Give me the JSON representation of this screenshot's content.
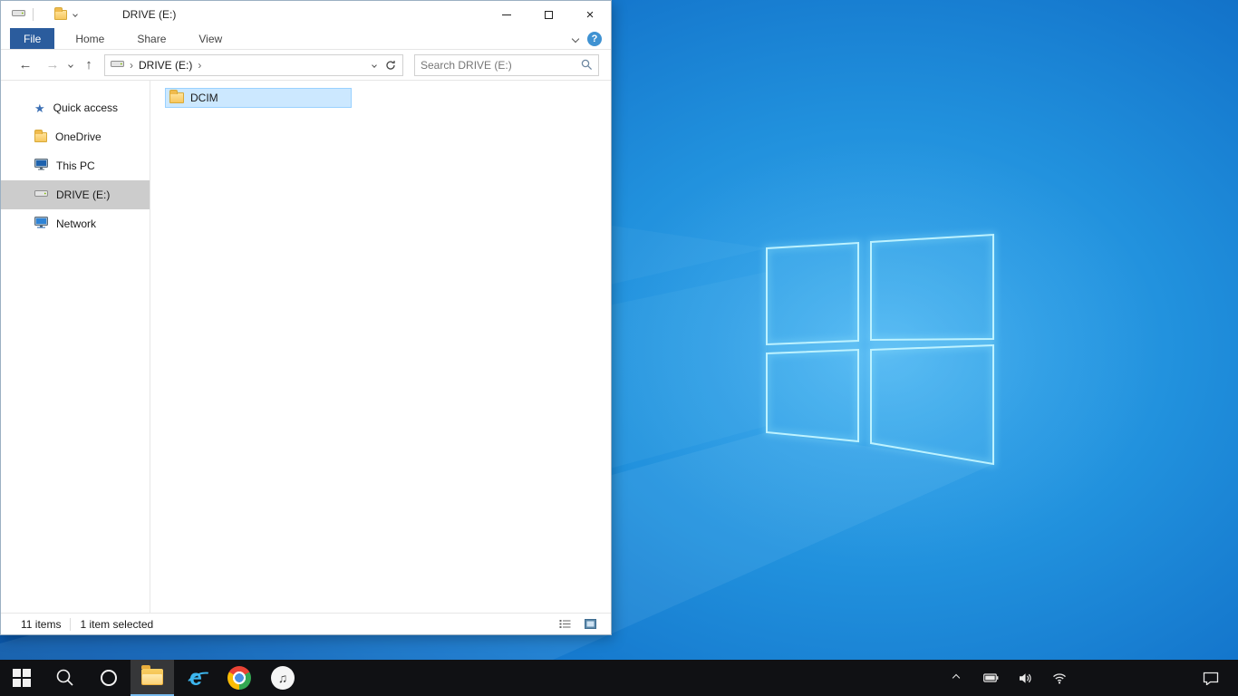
{
  "explorer": {
    "title": "DRIVE (E:)",
    "window_controls": {
      "close_glyph": "×"
    },
    "ribbon": {
      "file_tab": "File",
      "tabs": [
        {
          "label": "Home"
        },
        {
          "label": "Share"
        },
        {
          "label": "View"
        }
      ],
      "help_glyph": "?"
    },
    "navbar": {
      "back_glyph": "←",
      "forward_glyph": "→",
      "up_glyph": "↑",
      "breadcrumb_root": "DRIVE (E:)",
      "breadcrumb_chevron": "›",
      "search_placeholder": "Search DRIVE (E:)"
    },
    "sidebar": {
      "star_glyph": "★",
      "items": [
        {
          "label": "Quick access",
          "icon": "star-icon",
          "selected": false
        },
        {
          "label": "OneDrive",
          "icon": "folder-icon",
          "selected": false
        },
        {
          "label": "This PC",
          "icon": "computer-icon",
          "selected": false
        },
        {
          "label": "DRIVE (E:)",
          "icon": "drive-icon",
          "selected": true
        },
        {
          "label": "Network",
          "icon": "network-icon",
          "selected": false
        }
      ]
    },
    "content": {
      "files": [
        {
          "name": "DCIM",
          "selected": true
        }
      ]
    },
    "statusbar": {
      "items_count": "11 items",
      "selection": "1 item selected"
    }
  },
  "desktop": {
    "wallpaper": "windows-10-hero-blue-logo"
  },
  "taskbar": {
    "apps": [
      {
        "name": "start"
      },
      {
        "name": "search"
      },
      {
        "name": "cortana"
      },
      {
        "name": "file-explorer",
        "active": true
      },
      {
        "name": "internet-explorer"
      },
      {
        "name": "chrome"
      },
      {
        "name": "itunes"
      }
    ],
    "ie_glyph": "e",
    "itunes_glyph": "♫"
  },
  "colors": {
    "file_tab_blue": "#2b5c9d",
    "selection_blue_bg": "#cce8ff",
    "selection_blue_border": "#99d1ff",
    "sidebar_selected_gray": "#cccccc",
    "taskbar_black": "#101114",
    "wallpaper_blue": "#1476cc",
    "logo_edge_cyan": "#9ceaff"
  }
}
